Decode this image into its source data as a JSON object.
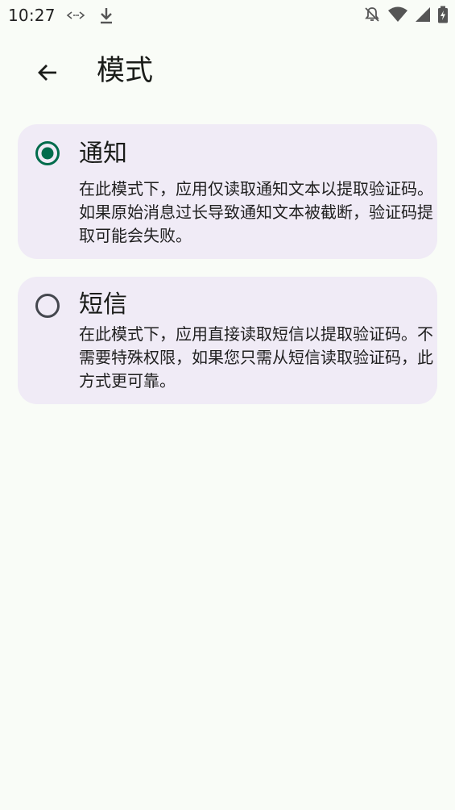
{
  "status_bar": {
    "time": "10:27",
    "icons": [
      "code-icon",
      "download-icon",
      "notifications-off-icon",
      "wifi-icon",
      "signal-icon",
      "battery-charging-icon"
    ]
  },
  "app_bar": {
    "back_icon": "arrow-back-icon",
    "title": "模式"
  },
  "options": [
    {
      "id": "notification",
      "label": "通知",
      "description": "在此模式下，应用仅读取通知文本以提取验证码。如果原始消息过长导致通知文本被截断，验证码提取可能会失败。",
      "selected": true
    },
    {
      "id": "sms",
      "label": "短信",
      "description": "在此模式下，应用直接读取短信以提取验证码。不需要特殊权限，如果您只需从短信读取验证码，此方式更可靠。",
      "selected": false
    }
  ],
  "colors": {
    "background": "#f9fcf7",
    "card": "#f0ebf6",
    "radio_selected": "#006c4c",
    "radio_unselected": "#44474e"
  }
}
